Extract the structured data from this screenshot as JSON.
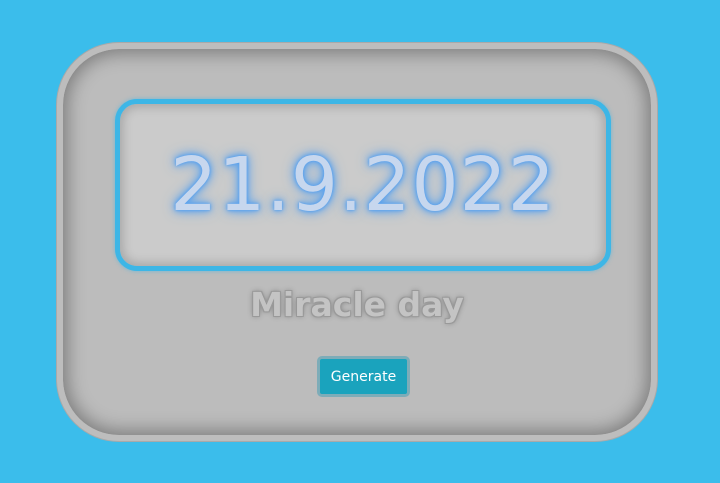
{
  "display": {
    "date": "21.9.2022"
  },
  "label": {
    "text": "Miracle day"
  },
  "generate_button": {
    "label": "Generate"
  },
  "colors": {
    "background": "#3bbdeb",
    "card": "#bcbcbc",
    "display_border": "#3db6e6",
    "date_glow": "#5aa2ee",
    "button": "#1aa3bd"
  }
}
